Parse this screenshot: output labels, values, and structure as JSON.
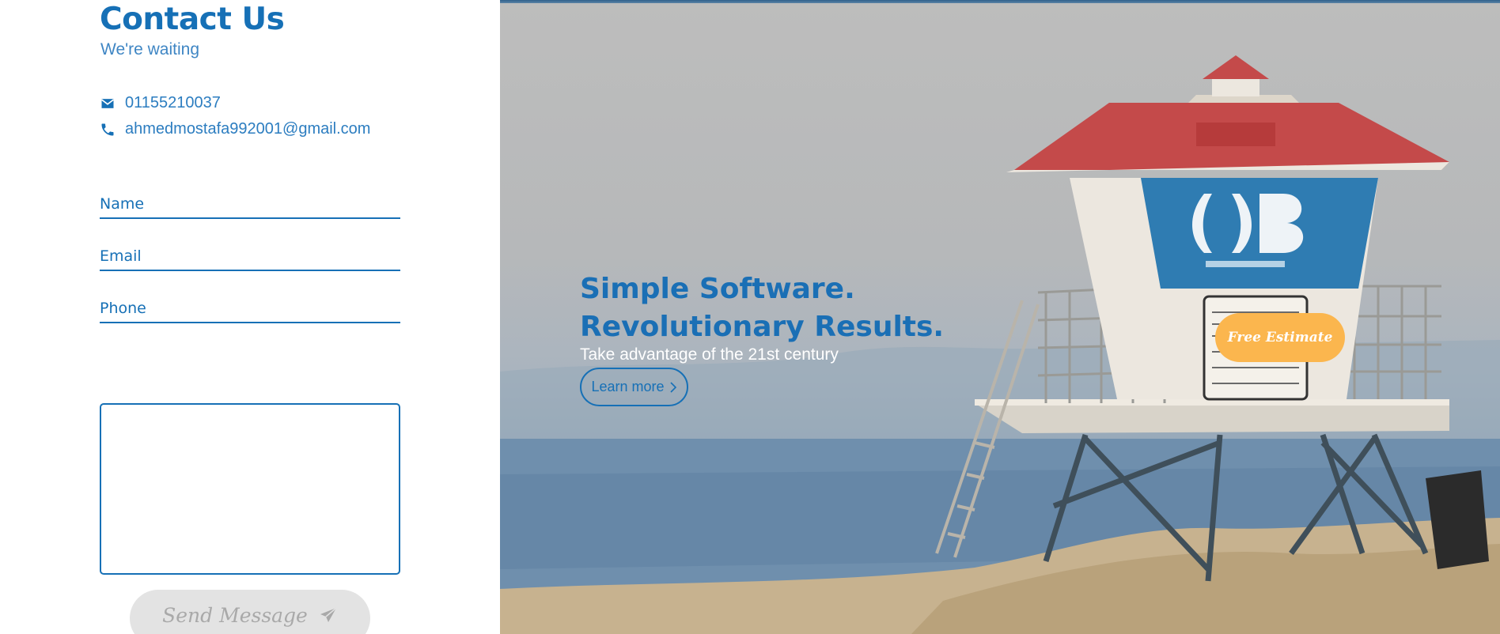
{
  "contact": {
    "title": "Contact Us",
    "subtitle": "We're waiting",
    "phone": "01155210037",
    "email": "ahmedmostafa992001@gmail.com",
    "form": {
      "name_label": "Name",
      "email_label": "Email",
      "phone_label": "Phone",
      "message_value": ""
    },
    "send_label": "Send Message"
  },
  "hero": {
    "title_line1": "Simple Software.",
    "title_line2": "Revolutionary Results.",
    "subtitle": "Take advantage of the 21st century",
    "learn_more_label": "Learn more",
    "estimate_label": "Free Estimate"
  },
  "icons": {
    "mail": "envelope-icon",
    "phone": "phone-icon",
    "send": "paper-plane-icon",
    "chevron": "chevron-right-icon"
  },
  "colors": {
    "brand_blue": "#1670b6",
    "estimate_orange": "#fbb64e",
    "send_disabled": "#e3e3e3"
  }
}
